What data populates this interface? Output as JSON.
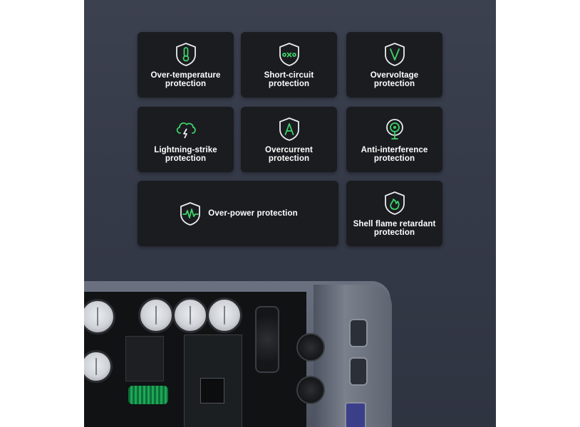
{
  "features": [
    {
      "label": "Over-temperature\nprotection",
      "icon": "thermometer-shield-icon"
    },
    {
      "label": "Short-circuit\nprotection",
      "icon": "short-circuit-shield-icon"
    },
    {
      "label": "Overvoltage\nprotection",
      "icon": "voltage-shield-icon"
    },
    {
      "label": "Lightning-strike\nprotection",
      "icon": "lightning-cloud-icon"
    },
    {
      "label": "Overcurrent\nprotection",
      "icon": "ampere-shield-icon"
    },
    {
      "label": "Anti-interference\nprotection",
      "icon": "signal-interference-icon"
    },
    {
      "label": "Over-power protection",
      "icon": "power-wave-shield-icon"
    },
    {
      "label": "Shell flame retardant\nprotection",
      "icon": "flame-shield-icon"
    }
  ],
  "colors": {
    "accent": "#3ed36a",
    "card_background": "#1b1c20",
    "panel_background": "#353a48"
  }
}
